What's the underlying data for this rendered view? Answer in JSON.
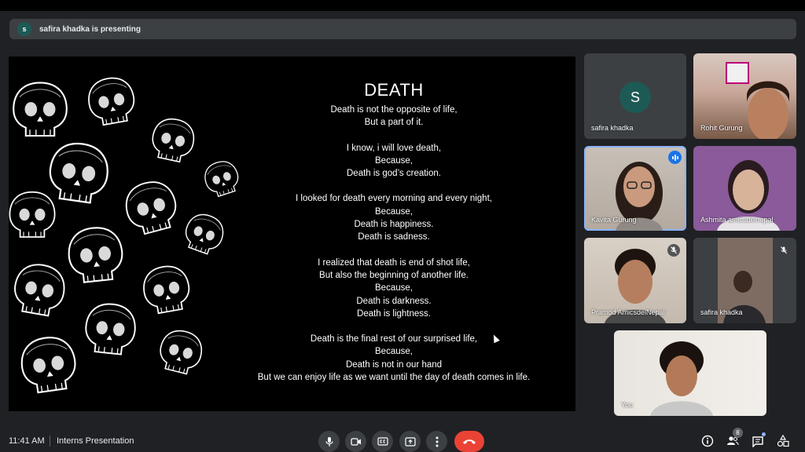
{
  "presenter_banner": {
    "avatar_letter": "s",
    "text": "safira khadka is presenting"
  },
  "slide": {
    "title": "DEATH",
    "stanzas": [
      [
        "Death is not the opposite of life,",
        "But a part of it."
      ],
      [
        "I know, i will love death,",
        "Because,",
        "Death is god’s creation."
      ],
      [
        "I looked for death every morning and every night,",
        "Because,",
        "Death is happiness.",
        "Death is sadness."
      ],
      [
        "I realized that death is end of shot life,",
        "But also the beginning of another life.",
        "Because,",
        "Death is darkness.",
        "Death is lightness."
      ],
      [
        "Death is the final rest of our surprised life,",
        "Because,",
        "Death is not in our hand",
        "But we can enjoy life as we want until the day of death comes in life."
      ]
    ]
  },
  "participants": [
    {
      "name": "safira khadka",
      "avatar_letter": "S",
      "status": "avatar"
    },
    {
      "name": "Rohit Gurung",
      "status": "video"
    },
    {
      "name": "Kavita Gurung",
      "status": "speaking"
    },
    {
      "name": "Ashmita amicsdelnepal",
      "status": "video"
    },
    {
      "name": "Pramod AmicsdelNepal",
      "status": "muted"
    },
    {
      "name": "safira khadka",
      "status": "muted"
    },
    {
      "name": "You",
      "status": "self"
    }
  ],
  "bottom": {
    "time": "11:41 AM",
    "meeting_name": "Interns Presentation",
    "participant_count": "8"
  },
  "colors": {
    "background": "#202124",
    "end_call": "#ea4335",
    "active_border": "#8ab4f8",
    "avatar": "#1e5a55"
  }
}
